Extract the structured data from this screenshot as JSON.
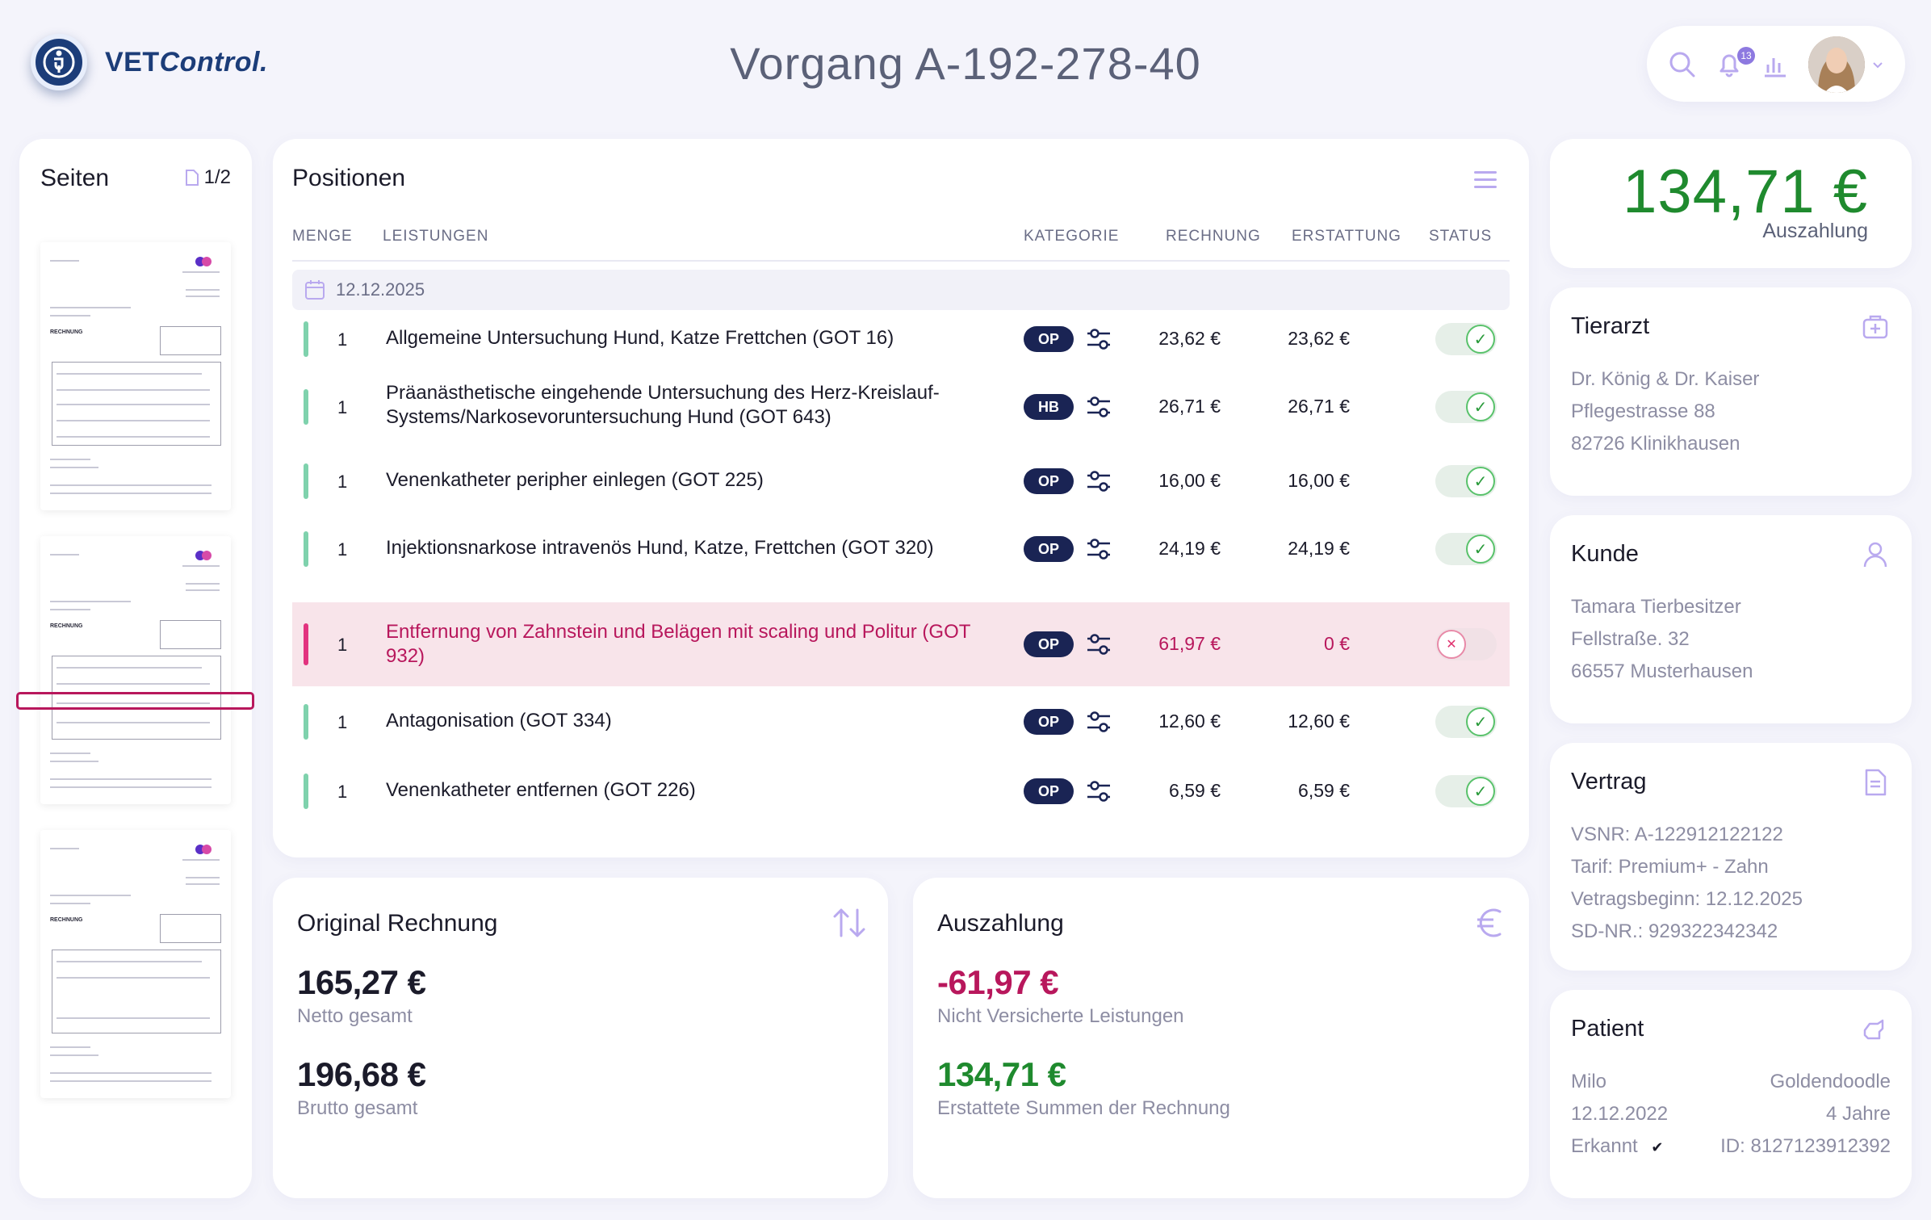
{
  "app": {
    "logo_text_1": "VET",
    "logo_text_2": "Control.",
    "title": "Vorgang A-192-278-40",
    "notifications_count": "13"
  },
  "seiten": {
    "title": "Seiten",
    "count": "1/2"
  },
  "positionen": {
    "title": "Positionen",
    "columns": {
      "menge": "MENGE",
      "leistungen": "LEISTUNGEN",
      "kategorie": "KATEGORIE",
      "rechnung": "RECHNUNG",
      "erstattung": "ERSTATTUNG",
      "status": "STATUS"
    },
    "date": "12.12.2025",
    "rows": [
      {
        "qty": "1",
        "desc": "Allgemeine Untersuchung Hund, Katze Frettchen (GOT 16)",
        "cat": "OP",
        "rechnung": "23,62 €",
        "erstattung": "23,62 €",
        "status": "approved"
      },
      {
        "qty": "1",
        "desc": "Präanästhetische eingehende Untersuchung des Herz-Kreislauf-Systems/Narkosevoruntersuchung Hund (GOT 643)",
        "cat": "HB",
        "rechnung": "26,71 €",
        "erstattung": "26,71 €",
        "status": "approved"
      },
      {
        "qty": "1",
        "desc": "Venenkatheter peripher einlegen (GOT 225)",
        "cat": "OP",
        "rechnung": "16,00 €",
        "erstattung": "16,00 €",
        "status": "approved"
      },
      {
        "qty": "1",
        "desc": "Injektionsnarkose intravenös Hund, Katze, Frettchen (GOT 320)",
        "cat": "OP",
        "rechnung": "24,19 €",
        "erstattung": "24,19 €",
        "status": "approved"
      },
      {
        "qty": "1",
        "desc": "Entfernung von Zahnstein und Belägen mit scaling und Politur (GOT 932)",
        "cat": "OP",
        "rechnung": "61,97 €",
        "erstattung": "0 €",
        "status": "rejected"
      },
      {
        "qty": "1",
        "desc": "Antagonisation (GOT 334)",
        "cat": "OP",
        "rechnung": "12,60 €",
        "erstattung": "12,60 €",
        "status": "approved"
      },
      {
        "qty": "1",
        "desc": "Venenkatheter entfernen (GOT 226)",
        "cat": "OP",
        "rechnung": "6,59 €",
        "erstattung": "6,59 €",
        "status": "approved"
      }
    ]
  },
  "original_rechnung": {
    "title": "Original Rechnung",
    "netto": "165,27 €",
    "netto_label": "Netto gesamt",
    "brutto": "196,68 €",
    "brutto_label": "Brutto gesamt"
  },
  "auszahlung_card": {
    "title": "Auszahlung",
    "nicht_versichert": "-61,97 €",
    "nicht_versichert_label": "Nicht Versicherte Leistungen",
    "erstattet": "134,71 €",
    "erstattet_label": "Erstattete Summen der Rechnung"
  },
  "total": {
    "amount": "134,71 €",
    "label": "Auszahlung"
  },
  "tierarzt": {
    "title": "Tierarzt",
    "lines": [
      "Dr. König & Dr. Kaiser",
      "Pflegestrasse 88",
      "82726 Klinikhausen"
    ]
  },
  "kunde": {
    "title": "Kunde",
    "lines": [
      "Tamara Tierbesitzer",
      "Fellstraße. 32",
      "66557 Musterhausen"
    ]
  },
  "vertrag": {
    "title": "Vertrag",
    "lines": [
      "VSNR: A-122912122122",
      "Tarif: Premium+ - Zahn",
      "Vetragsbeginn: 12.12.2025",
      "SD-NR.: 929322342342"
    ]
  },
  "patient": {
    "title": "Patient",
    "name": "Milo",
    "breed": "Goldendoodle",
    "birth": "12.12.2022",
    "age": "4 Jahre",
    "status": "Erkannt",
    "status_check": "✔",
    "id": "ID: 8127123912392"
  },
  "colors": {
    "brand": "#1c3d79",
    "positive": "#1f8a2e",
    "negative": "#b8175c",
    "accent": "#8d79e0"
  }
}
